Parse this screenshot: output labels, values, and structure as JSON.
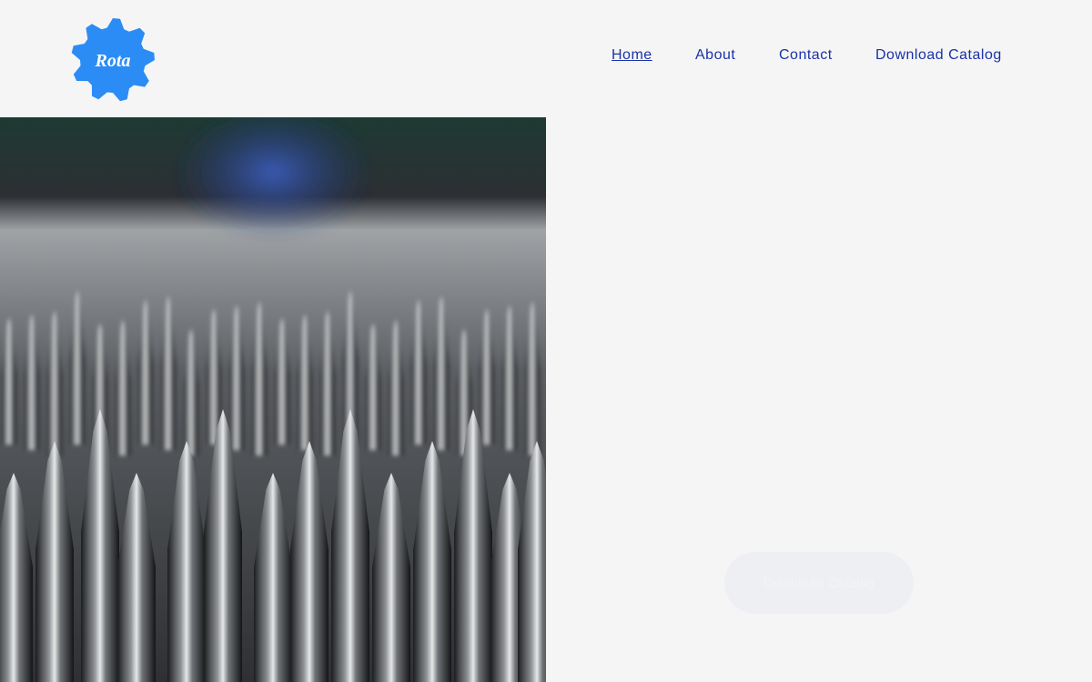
{
  "brand": {
    "logo_text": "Rota",
    "logo_color": "#2b8cf5"
  },
  "nav": {
    "items": [
      {
        "label": "Home",
        "active": true
      },
      {
        "label": "About",
        "active": false
      },
      {
        "label": "Contact",
        "active": false
      },
      {
        "label": "Download Catalog",
        "active": false
      }
    ]
  },
  "hero": {
    "image_icon": "hero-photo",
    "cta_label": "Download Catalog"
  },
  "colors": {
    "background": "#f5f5f5",
    "nav_link": "#1a32a8",
    "cta_bg": "#eeeff3"
  }
}
